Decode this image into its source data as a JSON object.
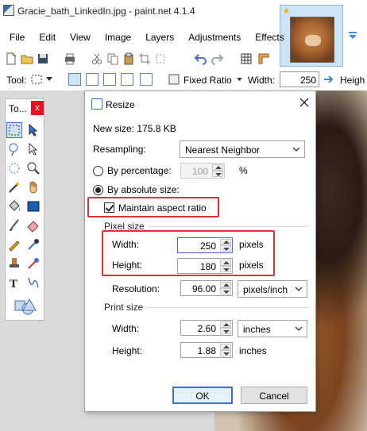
{
  "window": {
    "title": "Gracie_bath_LinkedIn.jpg - paint.net 4.1.4"
  },
  "menu": [
    "File",
    "Edit",
    "View",
    "Image",
    "Layers",
    "Adjustments",
    "Effects"
  ],
  "toolbar": {
    "tool_label": "Tool:",
    "fixed_ratio_label": "Fixed Ratio",
    "width_label": "Width:",
    "width_value": "250",
    "height_label": "Heigh"
  },
  "tools_panel": {
    "title": "To...",
    "close": "x"
  },
  "dialog": {
    "title": "Resize",
    "new_size": "New size: 175.8 KB",
    "resampling_label": "Resampling:",
    "resampling_value": "Nearest Neighbor",
    "by_percentage_label": "By percentage:",
    "percentage_value": "100",
    "percent_symbol": "%",
    "by_absolute_label": "By absolute size:",
    "maintain_label": "Maintain aspect ratio",
    "pixel_size_label": "Pixel size",
    "width_label": "Width:",
    "width_value": "250",
    "width_unit": "pixels",
    "height_label": "Height:",
    "height_value": "180",
    "height_unit": "pixels",
    "resolution_label": "Resolution:",
    "resolution_value": "96.00",
    "resolution_unit": "pixels/inch",
    "print_size_label": "Print size",
    "print_width_label": "Width:",
    "print_width_value": "2.60",
    "print_width_unit": "inches",
    "print_height_label": "Height:",
    "print_height_value": "1.88",
    "print_height_unit": "inches",
    "ok_label": "OK",
    "cancel_label": "Cancel"
  },
  "colors": {
    "accent": "#3c6fd8",
    "highlight_box": "#d7343a",
    "close_red": "#e81123"
  }
}
